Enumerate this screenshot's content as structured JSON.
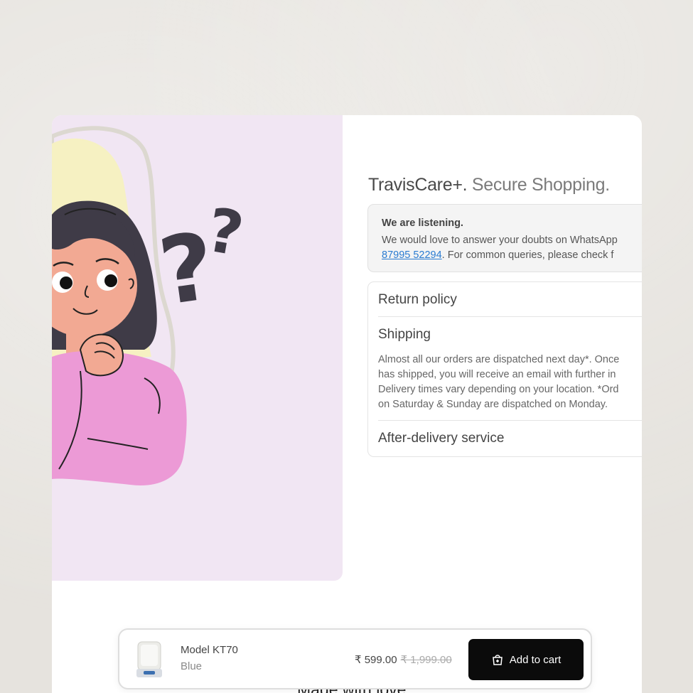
{
  "headline": {
    "brand": "TravisCare+.",
    "tagline": " Secure Shopping."
  },
  "notice": {
    "title": "We are listening.",
    "line1": "We would love to answer your doubts on WhatsApp",
    "phone": "87995 52294",
    "line2_rest": ". For common queries, please check f"
  },
  "accordion": {
    "return_policy": "Return policy",
    "shipping": "Shipping",
    "shipping_body": [
      "Almost all our orders are dispatched next day*. Once",
      "has shipped, you will receive an email with further in",
      "Delivery times vary depending on your location. *Ord",
      "on Saturday & Sunday are dispatched on Monday."
    ],
    "after_delivery": "After-delivery service"
  },
  "footer": {
    "text": "Made with love"
  },
  "cart": {
    "product_name": "Model KT70",
    "variant": "Blue",
    "price": "₹ 599.00",
    "old_price": "₹ 1,999.00",
    "button_label": "Add to cart",
    "icon": "bag-plus-icon"
  },
  "colors": {
    "illustration_bg": "#f1e6f3",
    "button": "#0b0b0b",
    "link": "#2a7bd1"
  }
}
